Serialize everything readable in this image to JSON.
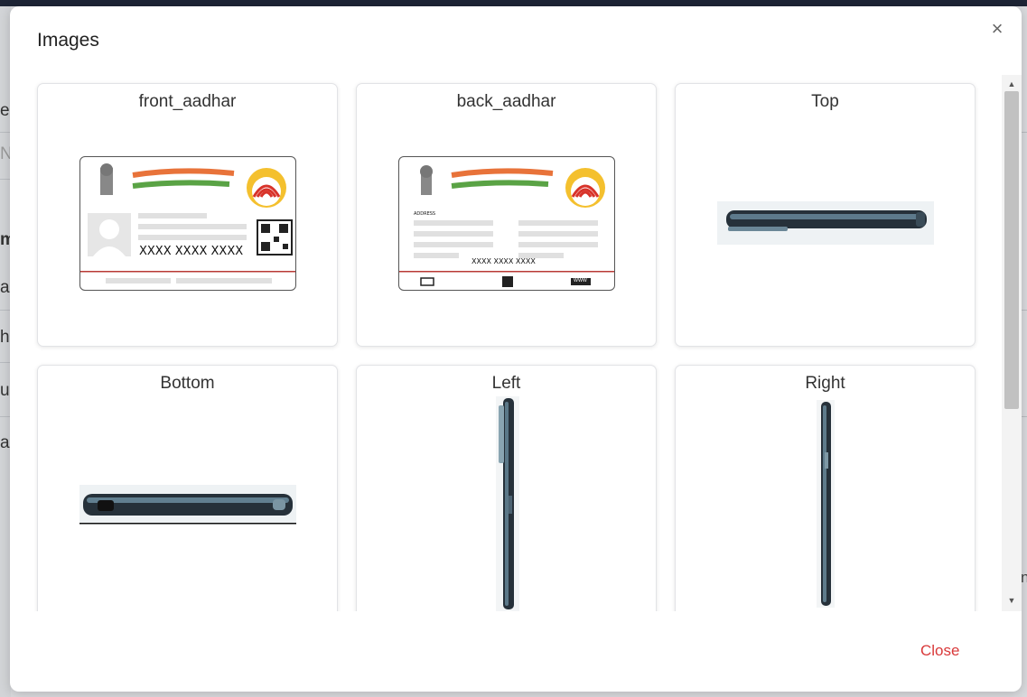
{
  "modal": {
    "title": "Images",
    "close_icon": "close-icon",
    "footer_close_label": "Close"
  },
  "cards": [
    {
      "label": "front_aadhar"
    },
    {
      "label": "back_aadhar"
    },
    {
      "label": "Top"
    },
    {
      "label": "Bottom"
    },
    {
      "label": "Left"
    },
    {
      "label": "Right"
    }
  ],
  "aadhaar_front": {
    "number": "XXXX XXXX XXXX"
  },
  "aadhaar_back": {
    "address_label": "ADDRESS",
    "number": "XXXX XXXX XXXX",
    "www": "WWW"
  },
  "background": {
    "fragments": [
      "e,",
      "N",
      "m",
      "ar",
      "hr",
      "ul",
      "ar"
    ],
    "right_fragment": "n"
  },
  "colors": {
    "close_accent": "#d9393a",
    "topbar": "#1d2435"
  }
}
